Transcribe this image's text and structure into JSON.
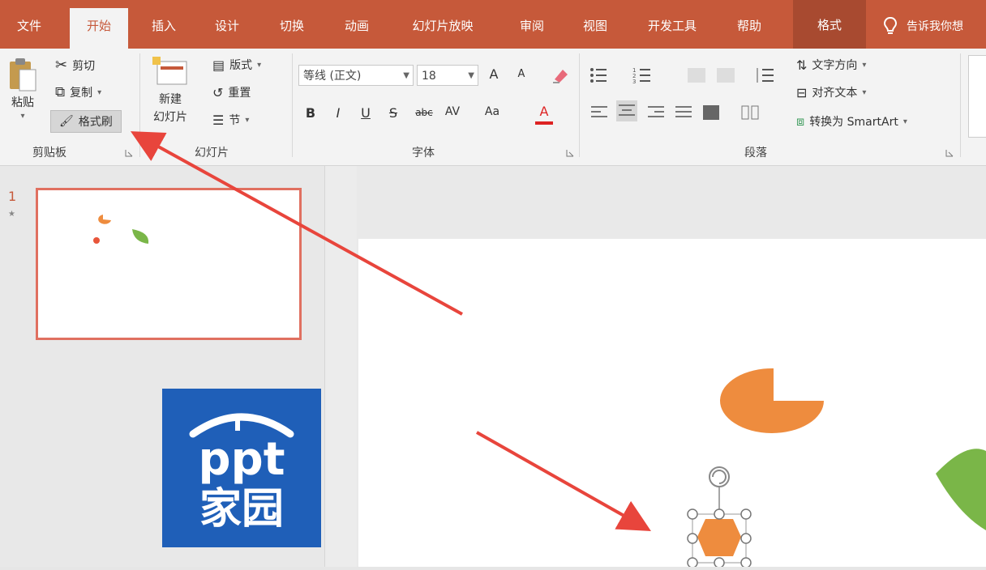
{
  "tabs": [
    {
      "label": "文件",
      "active": false
    },
    {
      "label": "开始",
      "active": true
    },
    {
      "label": "插入",
      "active": false
    },
    {
      "label": "设计",
      "active": false
    },
    {
      "label": "切换",
      "active": false
    },
    {
      "label": "动画",
      "active": false
    },
    {
      "label": "幻灯片放映",
      "active": false
    },
    {
      "label": "审阅",
      "active": false
    },
    {
      "label": "视图",
      "active": false
    },
    {
      "label": "开发工具",
      "active": false
    },
    {
      "label": "帮助",
      "active": false
    },
    {
      "label": "格式",
      "active": false
    }
  ],
  "search": {
    "text": "告诉我你想"
  },
  "clipboard": {
    "paste": "粘贴",
    "cut": "剪切",
    "copy": "复制",
    "format_painter": "格式刷",
    "group": "剪贴板"
  },
  "slides": {
    "new_slide_line1": "新建",
    "new_slide_line2": "幻灯片",
    "layout": "版式",
    "reset": "重置",
    "section": "节",
    "group": "幻灯片"
  },
  "font": {
    "name": "等线 (正文)",
    "size": "18",
    "bold": "B",
    "italic": "I",
    "underline": "U",
    "strike": "S",
    "abc": "abc",
    "av": "AV",
    "aa": "Aa",
    "grow": "A",
    "shrink": "A",
    "color_a": "A",
    "group": "字体"
  },
  "paragraph": {
    "text_direction": "文字方向",
    "align_text": "对齐文本",
    "smartart": "转换为 SmartArt",
    "group": "段落"
  },
  "slide_panel": {
    "number": "1",
    "star": "★"
  },
  "logo": {
    "line1": "ppt",
    "line2": "家园"
  },
  "colors": {
    "accent": "#c6593a",
    "pie": "#ee8c3e",
    "leaf": "#7ab648",
    "arrow": "#e8453c",
    "logo_bg": "#1f5fb8"
  }
}
